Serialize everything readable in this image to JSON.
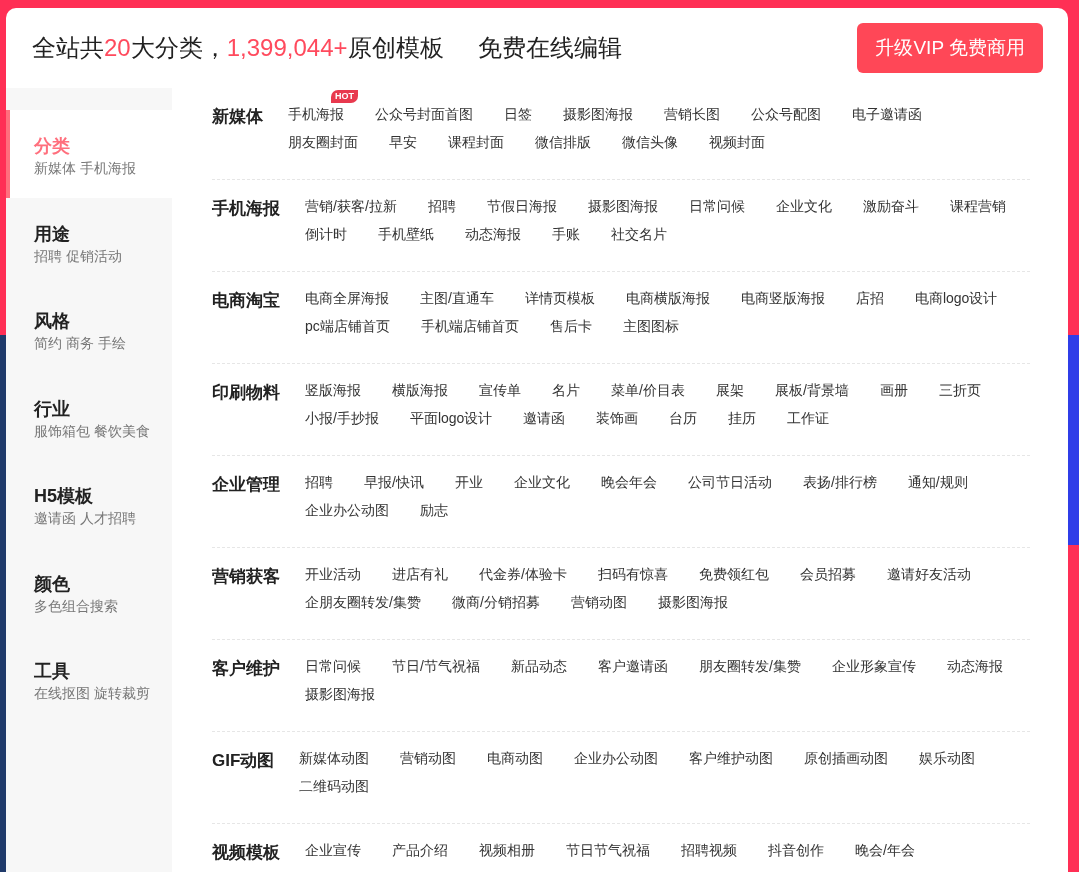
{
  "header": {
    "title_parts": [
      {
        "text": "全站共",
        "highlight": false
      },
      {
        "text": "20",
        "highlight": true
      },
      {
        "text": "大分类，",
        "highlight": false
      },
      {
        "text": "1,399,044+",
        "highlight": true
      },
      {
        "text": "原创模板",
        "highlight": false
      }
    ],
    "slogan": "免费在线编辑",
    "vip_button": "升级VIP 免费商用"
  },
  "sidebar": {
    "items": [
      {
        "title": "分类",
        "subtitle": "新媒体 手机海报",
        "selected": true
      },
      {
        "title": "用途",
        "subtitle": "招聘 促销活动",
        "selected": false
      },
      {
        "title": "风格",
        "subtitle": "简约 商务 手绘",
        "selected": false
      },
      {
        "title": "行业",
        "subtitle": "服饰箱包 餐饮美食",
        "selected": false
      },
      {
        "title": "H5模板",
        "subtitle": "邀请函 人才招聘",
        "selected": false
      },
      {
        "title": "颜色",
        "subtitle": "多色组合搜索",
        "selected": false
      },
      {
        "title": "工具",
        "subtitle": "在线抠图 旋转裁剪",
        "selected": false
      }
    ]
  },
  "categories": [
    {
      "title": "新媒体",
      "items": [
        {
          "label": "手机海报",
          "badge": "HOT"
        },
        {
          "label": "公众号封面首图"
        },
        {
          "label": "日签"
        },
        {
          "label": "摄影图海报"
        },
        {
          "label": "营销长图"
        },
        {
          "label": "公众号配图"
        },
        {
          "label": "电子邀请函"
        },
        {
          "label": "朋友圈封面"
        },
        {
          "label": "早安"
        },
        {
          "label": "课程封面"
        },
        {
          "label": "微信排版"
        },
        {
          "label": "微信头像"
        },
        {
          "label": "视频封面"
        }
      ]
    },
    {
      "title": "手机海报",
      "items": [
        {
          "label": "营销/获客/拉新"
        },
        {
          "label": "招聘"
        },
        {
          "label": "节假日海报"
        },
        {
          "label": "摄影图海报"
        },
        {
          "label": "日常问候"
        },
        {
          "label": "企业文化"
        },
        {
          "label": "激励奋斗"
        },
        {
          "label": "课程营销"
        },
        {
          "label": "倒计时"
        },
        {
          "label": "手机壁纸"
        },
        {
          "label": "动态海报"
        },
        {
          "label": "手账"
        },
        {
          "label": "社交名片"
        }
      ]
    },
    {
      "title": "电商淘宝",
      "items": [
        {
          "label": "电商全屏海报"
        },
        {
          "label": "主图/直通车"
        },
        {
          "label": "详情页模板"
        },
        {
          "label": "电商横版海报"
        },
        {
          "label": "电商竖版海报"
        },
        {
          "label": "店招"
        },
        {
          "label": "电商logo设计"
        },
        {
          "label": "pc端店铺首页"
        },
        {
          "label": "手机端店铺首页"
        },
        {
          "label": "售后卡"
        },
        {
          "label": "主图图标"
        }
      ]
    },
    {
      "title": "印刷物料",
      "items": [
        {
          "label": "竖版海报"
        },
        {
          "label": "横版海报"
        },
        {
          "label": "宣传单"
        },
        {
          "label": "名片"
        },
        {
          "label": "菜单/价目表"
        },
        {
          "label": "展架"
        },
        {
          "label": "展板/背景墙"
        },
        {
          "label": "画册"
        },
        {
          "label": "三折页"
        },
        {
          "label": "小报/手抄报"
        },
        {
          "label": "平面logo设计"
        },
        {
          "label": "邀请函"
        },
        {
          "label": "装饰画"
        },
        {
          "label": "台历"
        },
        {
          "label": "挂历"
        },
        {
          "label": "工作证"
        }
      ]
    },
    {
      "title": "企业管理",
      "items": [
        {
          "label": "招聘"
        },
        {
          "label": "早报/快讯"
        },
        {
          "label": "开业"
        },
        {
          "label": "企业文化"
        },
        {
          "label": "晚会年会"
        },
        {
          "label": "公司节日活动"
        },
        {
          "label": "表扬/排行榜"
        },
        {
          "label": "通知/规则"
        },
        {
          "label": "企业办公动图"
        },
        {
          "label": "励志"
        }
      ]
    },
    {
      "title": "营销获客",
      "items": [
        {
          "label": "开业活动"
        },
        {
          "label": "进店有礼"
        },
        {
          "label": "代金券/体验卡"
        },
        {
          "label": "扫码有惊喜"
        },
        {
          "label": "免费领红包"
        },
        {
          "label": "会员招募"
        },
        {
          "label": "邀请好友活动"
        },
        {
          "label": "企朋友圈转发/集赞"
        },
        {
          "label": "微商/分销招募"
        },
        {
          "label": "营销动图"
        },
        {
          "label": "摄影图海报"
        }
      ]
    },
    {
      "title": "客户维护",
      "items": [
        {
          "label": "日常问候"
        },
        {
          "label": "节日/节气祝福"
        },
        {
          "label": "新品动态"
        },
        {
          "label": "客户邀请函"
        },
        {
          "label": "朋友圈转发/集赞"
        },
        {
          "label": "企业形象宣传"
        },
        {
          "label": "动态海报"
        },
        {
          "label": "摄影图海报"
        }
      ]
    },
    {
      "title": "GIF动图",
      "items": [
        {
          "label": "新媒体动图"
        },
        {
          "label": "营销动图"
        },
        {
          "label": "电商动图"
        },
        {
          "label": "企业办公动图"
        },
        {
          "label": "客户维护动图"
        },
        {
          "label": "原创插画动图"
        },
        {
          "label": "娱乐动图"
        },
        {
          "label": "二维码动图"
        }
      ]
    },
    {
      "title": "视频模板",
      "items": [
        {
          "label": "企业宣传"
        },
        {
          "label": "产品介绍"
        },
        {
          "label": "视频相册"
        },
        {
          "label": "节日节气祝福"
        },
        {
          "label": "招聘视频"
        },
        {
          "label": "抖音创作"
        },
        {
          "label": "晚会/年会"
        }
      ]
    }
  ]
}
